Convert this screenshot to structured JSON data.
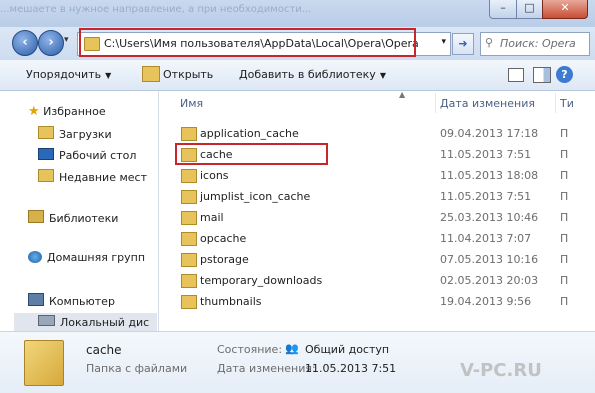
{
  "background_text": "...мешаете в нужное направление, а при необходимости...",
  "window_controls": {
    "minimize": "–",
    "maximize": "□",
    "close": "✕"
  },
  "nav": {
    "address_path": "C:\\Users\\Имя пользователя\\AppData\\Local\\Opera\\Opera",
    "search_placeholder": "Поиск: Opera"
  },
  "commands": {
    "organize": "Упорядочить",
    "open": "Открыть",
    "add_to_library": "Добавить в библиотеку"
  },
  "sidebar": {
    "favorites": "Избранное",
    "downloads": "Загрузки",
    "desktop": "Рабочий стол",
    "recent": "Недавние мест",
    "libraries": "Библиотеки",
    "homegroup": "Домашняя групп",
    "computer": "Компьютер",
    "local_disk": "Локальный дис"
  },
  "columns": {
    "name": "Имя",
    "date": "Дата изменения",
    "type": "Ти"
  },
  "files": [
    {
      "name": "application_cache",
      "date": "09.04.2013 17:18",
      "type": "П"
    },
    {
      "name": "cache",
      "date": "11.05.2013 7:51",
      "type": "П"
    },
    {
      "name": "icons",
      "date": "11.05.2013 18:08",
      "type": "П"
    },
    {
      "name": "jumplist_icon_cache",
      "date": "11.05.2013 7:51",
      "type": "П"
    },
    {
      "name": "mail",
      "date": "25.03.2013 10:46",
      "type": "П"
    },
    {
      "name": "opcache",
      "date": "11.04.2013 7:07",
      "type": "П"
    },
    {
      "name": "pstorage",
      "date": "07.05.2013 10:16",
      "type": "П"
    },
    {
      "name": "temporary_downloads",
      "date": "02.05.2013 20:03",
      "type": "П"
    },
    {
      "name": "thumbnails",
      "date": "19.04.2013 9:56",
      "type": "П"
    }
  ],
  "details": {
    "name": "cache",
    "type": "Папка с файлами",
    "state_label": "Состояние:",
    "state_value": "Общий доступ",
    "date_label": "Дата изменения:",
    "date_value": "11.05.2013 7:51"
  },
  "watermark": "V-PC.RU",
  "colors": {
    "highlight": "#c8262d",
    "accent": "#2e5ea8"
  }
}
